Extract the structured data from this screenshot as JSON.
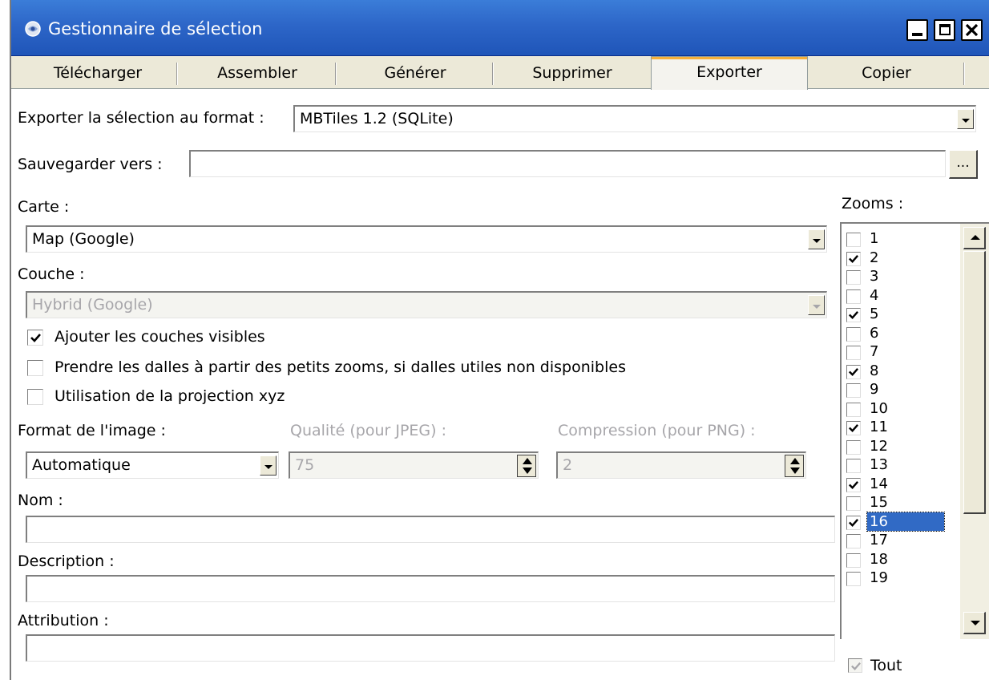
{
  "window": {
    "title": "Gestionnaire de sélection",
    "app_icon": "app-icon",
    "controls": [
      "minimize-icon",
      "maximize-icon",
      "close-icon"
    ]
  },
  "tabs": [
    {
      "label": "Télécharger",
      "active": false
    },
    {
      "label": "Assembler",
      "active": false
    },
    {
      "label": "Générer",
      "active": false
    },
    {
      "label": "Supprimer",
      "active": false
    },
    {
      "label": "Exporter",
      "active": true
    },
    {
      "label": "Copier",
      "active": false
    }
  ],
  "export": {
    "format_label": "Exporter la sélection au format :",
    "format_value": "MBTiles 1.2 (SQLite)",
    "save_label": "Sauvegarder vers :",
    "save_value": "",
    "browse_label": "..."
  },
  "map": {
    "carte_label": "Carte :",
    "carte_value": "Map (Google)",
    "couche_label": "Couche :",
    "couche_value": "Hybrid (Google)"
  },
  "options": [
    {
      "label": "Ajouter les couches visibles",
      "checked": true
    },
    {
      "label": "Prendre les dalles à partir des petits zooms, si dalles utiles non disponibles",
      "checked": false
    },
    {
      "label": "Utilisation de la projection xyz",
      "checked": false
    }
  ],
  "image": {
    "format_label": "Format de l'image :",
    "format_value": "Automatique",
    "quality_label": "Qualité (pour JPEG) :",
    "quality_value": "75",
    "compression_label": "Compression (pour PNG) :",
    "compression_value": "2"
  },
  "metadata": {
    "nom_label": "Nom :",
    "nom_value": "",
    "description_label": "Description :",
    "description_value": "",
    "attribution_label": "Attribution :",
    "attribution_value": ""
  },
  "zooms": {
    "label": "Zooms :",
    "items": [
      {
        "level": "1",
        "checked": false,
        "selected": false
      },
      {
        "level": "2",
        "checked": true,
        "selected": false
      },
      {
        "level": "3",
        "checked": false,
        "selected": false
      },
      {
        "level": "4",
        "checked": false,
        "selected": false
      },
      {
        "level": "5",
        "checked": true,
        "selected": false
      },
      {
        "level": "6",
        "checked": false,
        "selected": false
      },
      {
        "level": "7",
        "checked": false,
        "selected": false
      },
      {
        "level": "8",
        "checked": true,
        "selected": false
      },
      {
        "level": "9",
        "checked": false,
        "selected": false
      },
      {
        "level": "10",
        "checked": false,
        "selected": false
      },
      {
        "level": "11",
        "checked": true,
        "selected": false
      },
      {
        "level": "12",
        "checked": false,
        "selected": false
      },
      {
        "level": "13",
        "checked": false,
        "selected": false
      },
      {
        "level": "14",
        "checked": true,
        "selected": false
      },
      {
        "level": "15",
        "checked": false,
        "selected": false
      },
      {
        "level": "16",
        "checked": true,
        "selected": true
      },
      {
        "level": "17",
        "checked": false,
        "selected": false
      },
      {
        "level": "18",
        "checked": false,
        "selected": false
      },
      {
        "level": "19",
        "checked": false,
        "selected": false
      }
    ],
    "all_label": "Tout",
    "all_checked": true
  },
  "colors": {
    "titlebar": "#2d66c8",
    "dialog_face": "#ece9d8",
    "selection": "#316ac5",
    "tab_highlight": "#f7b03a",
    "disabled_text": "#a7a6aa"
  }
}
